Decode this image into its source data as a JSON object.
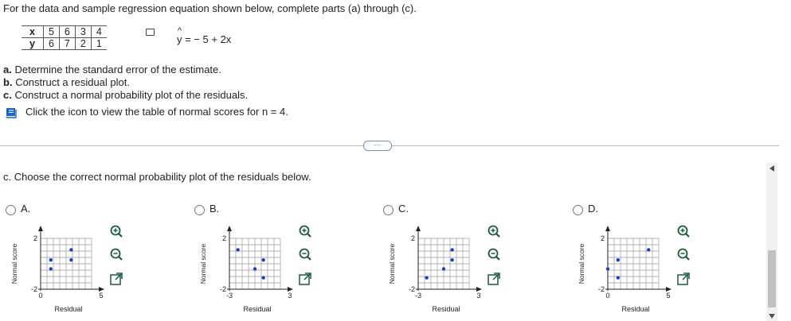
{
  "intro": "For the data and sample regression equation shown below, complete parts (a) through (c).",
  "table": {
    "x_label": "x",
    "y_label": "y",
    "x_values": [
      "5",
      "6",
      "3",
      "4"
    ],
    "y_values": [
      "6",
      "7",
      "2",
      "1"
    ]
  },
  "equation": {
    "hat": "^",
    "text": "y = − 5 + 2x"
  },
  "parts": [
    {
      "letter": "a.",
      "text": "Determine the standard error of the estimate."
    },
    {
      "letter": "b.",
      "text": "Construct a residual plot."
    },
    {
      "letter": "c.",
      "text": "Construct a normal probability plot of the residuals."
    }
  ],
  "icon_instruction": "Click the icon to view the table of normal scores for n = 4.",
  "more_button": "···",
  "question": "c. Choose the correct normal probability plot of the residuals below.",
  "options": [
    {
      "label": "A.",
      "xmin_label": "0",
      "xmax_label": "5",
      "ymax_label": "2",
      "ymin_label": "-2",
      "xlabel": "Residual",
      "ylabel": "Normal score"
    },
    {
      "label": "B.",
      "xmin_label": "-3",
      "xmax_label": "3",
      "ymax_label": "2",
      "ymin_label": "-2",
      "xlabel": "Residual",
      "ylabel": "Normal score"
    },
    {
      "label": "C.",
      "xmin_label": "-3",
      "xmax_label": "3",
      "ymax_label": "2",
      "ymin_label": "-2",
      "xlabel": "Residual",
      "ylabel": "Normal score"
    },
    {
      "label": "D.",
      "xmin_label": "0",
      "xmax_label": "5",
      "ymax_label": "2",
      "ymin_label": "-2",
      "xlabel": "Residual",
      "ylabel": "Normal score"
    }
  ],
  "chart_data": [
    {
      "type": "scatter",
      "title": "A.",
      "xlabel": "Residual",
      "ylabel": "Normal score",
      "xlim": [
        0,
        5
      ],
      "ylim": [
        -2,
        2
      ],
      "x": [
        1,
        1,
        3,
        3
      ],
      "y": [
        -0.4,
        0.3,
        0.3,
        1.1
      ],
      "color": "#1f3fbf"
    },
    {
      "type": "scatter",
      "title": "B.",
      "xlabel": "Residual",
      "ylabel": "Normal score",
      "xlim": [
        -3,
        3
      ],
      "ylim": [
        -2,
        2
      ],
      "x": [
        -2,
        0,
        1,
        1
      ],
      "y": [
        1.1,
        -0.4,
        0.3,
        -1.1
      ],
      "color": "#1f3fbf"
    },
    {
      "type": "scatter",
      "title": "C.",
      "xlabel": "Residual",
      "ylabel": "Normal score",
      "xlim": [
        -3,
        3
      ],
      "ylim": [
        -2,
        2
      ],
      "x": [
        -2,
        0,
        1,
        1
      ],
      "y": [
        -1.1,
        -0.4,
        0.3,
        1.1
      ],
      "color": "#1f3fbf"
    },
    {
      "type": "scatter",
      "title": "D.",
      "xlabel": "Residual",
      "ylabel": "Normal score",
      "xlim": [
        0,
        5
      ],
      "ylim": [
        -2,
        2
      ],
      "x": [
        0,
        1,
        1,
        4
      ],
      "y": [
        -0.4,
        -1.1,
        0.3,
        1.1
      ],
      "color": "#1f3fbf"
    }
  ]
}
